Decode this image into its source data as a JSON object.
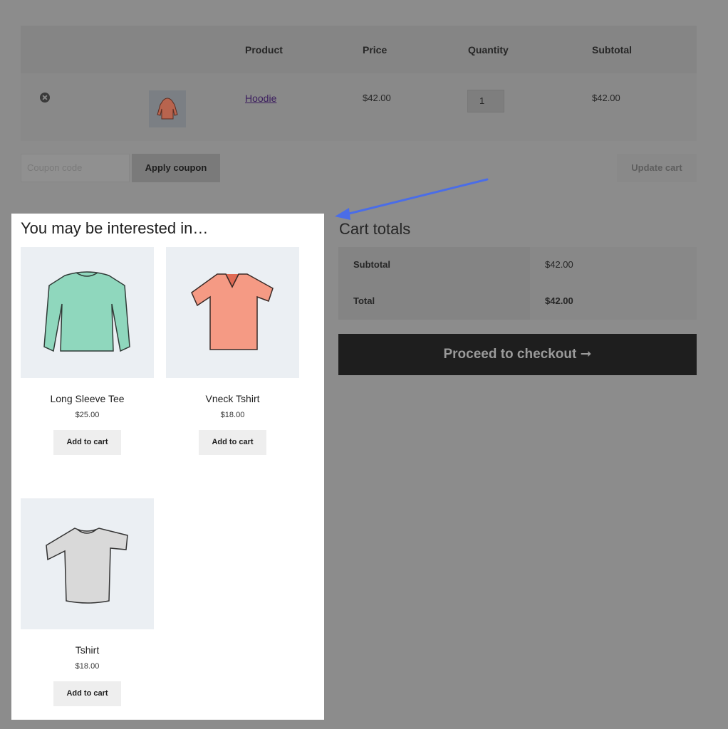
{
  "cart": {
    "headers": {
      "product": "Product",
      "price": "Price",
      "quantity": "Quantity",
      "subtotal": "Subtotal"
    },
    "row": {
      "product": "Hoodie",
      "price": "$42.00",
      "quantity": "1",
      "subtotal": "$42.00"
    }
  },
  "coupon": {
    "placeholder": "Coupon code",
    "apply_label": "Apply coupon",
    "update_label": "Update cart"
  },
  "totals": {
    "title": "Cart totals",
    "subtotal_label": "Subtotal",
    "subtotal_value": "$42.00",
    "total_label": "Total",
    "total_value": "$42.00",
    "checkout_label": "Proceed to checkout ➞"
  },
  "cross_sells": {
    "title": "You may be interested in…",
    "items": [
      {
        "name": "Long Sleeve Tee",
        "price": "$25.00",
        "button": "Add to cart",
        "color": "#8fd7bd"
      },
      {
        "name": "Vneck Tshirt",
        "price": "$18.00",
        "button": "Add to cart",
        "color": "#f59a84"
      },
      {
        "name": "Tshirt",
        "price": "$18.00",
        "button": "Add to cart",
        "color": "#d9d9d9"
      }
    ]
  },
  "colors": {
    "accent_arrow": "#4a6de8",
    "checkout_bg": "#1e1e1e"
  }
}
